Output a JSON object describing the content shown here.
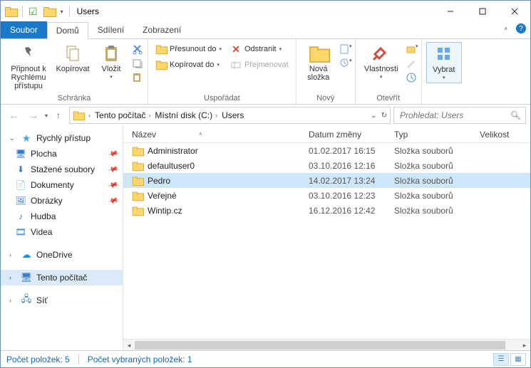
{
  "window": {
    "title": "Users"
  },
  "tabs": {
    "file": "Soubor",
    "home": "Domů",
    "share": "Sdílení",
    "view": "Zobrazení"
  },
  "ribbon": {
    "group_clipboard": "Schránka",
    "group_organize": "Uspořádat",
    "group_new": "Nový",
    "group_open": "Otevřít",
    "group_select": "",
    "pin": "Připnout k Rychlému přístupu",
    "copy": "Kopírovat",
    "paste": "Vložit",
    "moveto": "Přesunout do",
    "copyto": "Kopírovat do",
    "delete": "Odstranit",
    "rename": "Přejmenovat",
    "newfolder": "Nová složka",
    "properties": "Vlastnosti",
    "select": "Vybrat"
  },
  "breadcrumbs": {
    "items": [
      "Tento počítač",
      "Místní disk (C:)",
      "Users"
    ]
  },
  "search": {
    "placeholder": "Prohledat: Users"
  },
  "tree": {
    "quick": "Rychlý přístup",
    "desktop": "Plocha",
    "downloads": "Stažené soubory",
    "documents": "Dokumenty",
    "pictures": "Obrázky",
    "music": "Hudba",
    "videos": "Videa",
    "onedrive": "OneDrive",
    "thispc": "Tento počítač",
    "network": "Síť"
  },
  "columns": {
    "name": "Název",
    "date": "Datum změny",
    "type": "Typ",
    "size": "Velikost"
  },
  "rows": [
    {
      "name": "Administrator",
      "date": "01.02.2017 16:15",
      "type": "Složka souborů",
      "selected": false
    },
    {
      "name": "defaultuser0",
      "date": "03.10.2016 12:16",
      "type": "Složka souborů",
      "selected": false
    },
    {
      "name": "Pedro",
      "date": "14.02.2017 13:24",
      "type": "Složka souborů",
      "selected": true
    },
    {
      "name": "Veřejné",
      "date": "03.10.2016 12:23",
      "type": "Složka souborů",
      "selected": false
    },
    {
      "name": "Wintip.cz",
      "date": "16.12.2016 12:42",
      "type": "Složka souborů",
      "selected": false
    }
  ],
  "status": {
    "count_label": "Počet položek:",
    "count_value": "5",
    "sel_label": "Počet vybraných položek:",
    "sel_value": "1"
  }
}
